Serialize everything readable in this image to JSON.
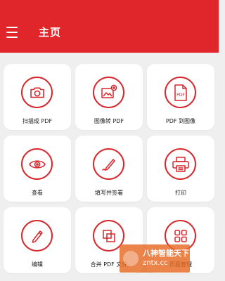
{
  "header": {
    "title": "主页",
    "menu_icon": "hamburger-menu-icon"
  },
  "colors": {
    "accent": "#e0262b",
    "background": "#efefef",
    "card": "#ffffff"
  },
  "tools": [
    {
      "label": "扫描成 PDF",
      "icon": "camera-icon"
    },
    {
      "label": "图像转 PDF",
      "icon": "image-add-icon"
    },
    {
      "label": "PDF 到图像",
      "icon": "pdf-file-icon"
    },
    {
      "label": "查看",
      "icon": "eye-icon"
    },
    {
      "label": "填写并签署",
      "icon": "signature-pen-icon"
    },
    {
      "label": "打印",
      "icon": "printer-icon"
    },
    {
      "label": "编辑",
      "icon": "pencil-icon"
    },
    {
      "label": "合并 PDF 文件",
      "icon": "merge-squares-icon"
    },
    {
      "label": "页面管理",
      "icon": "grid-apps-icon"
    }
  ],
  "watermark": {
    "title": "八神智能天下",
    "subtitle": "zntx.cc"
  }
}
